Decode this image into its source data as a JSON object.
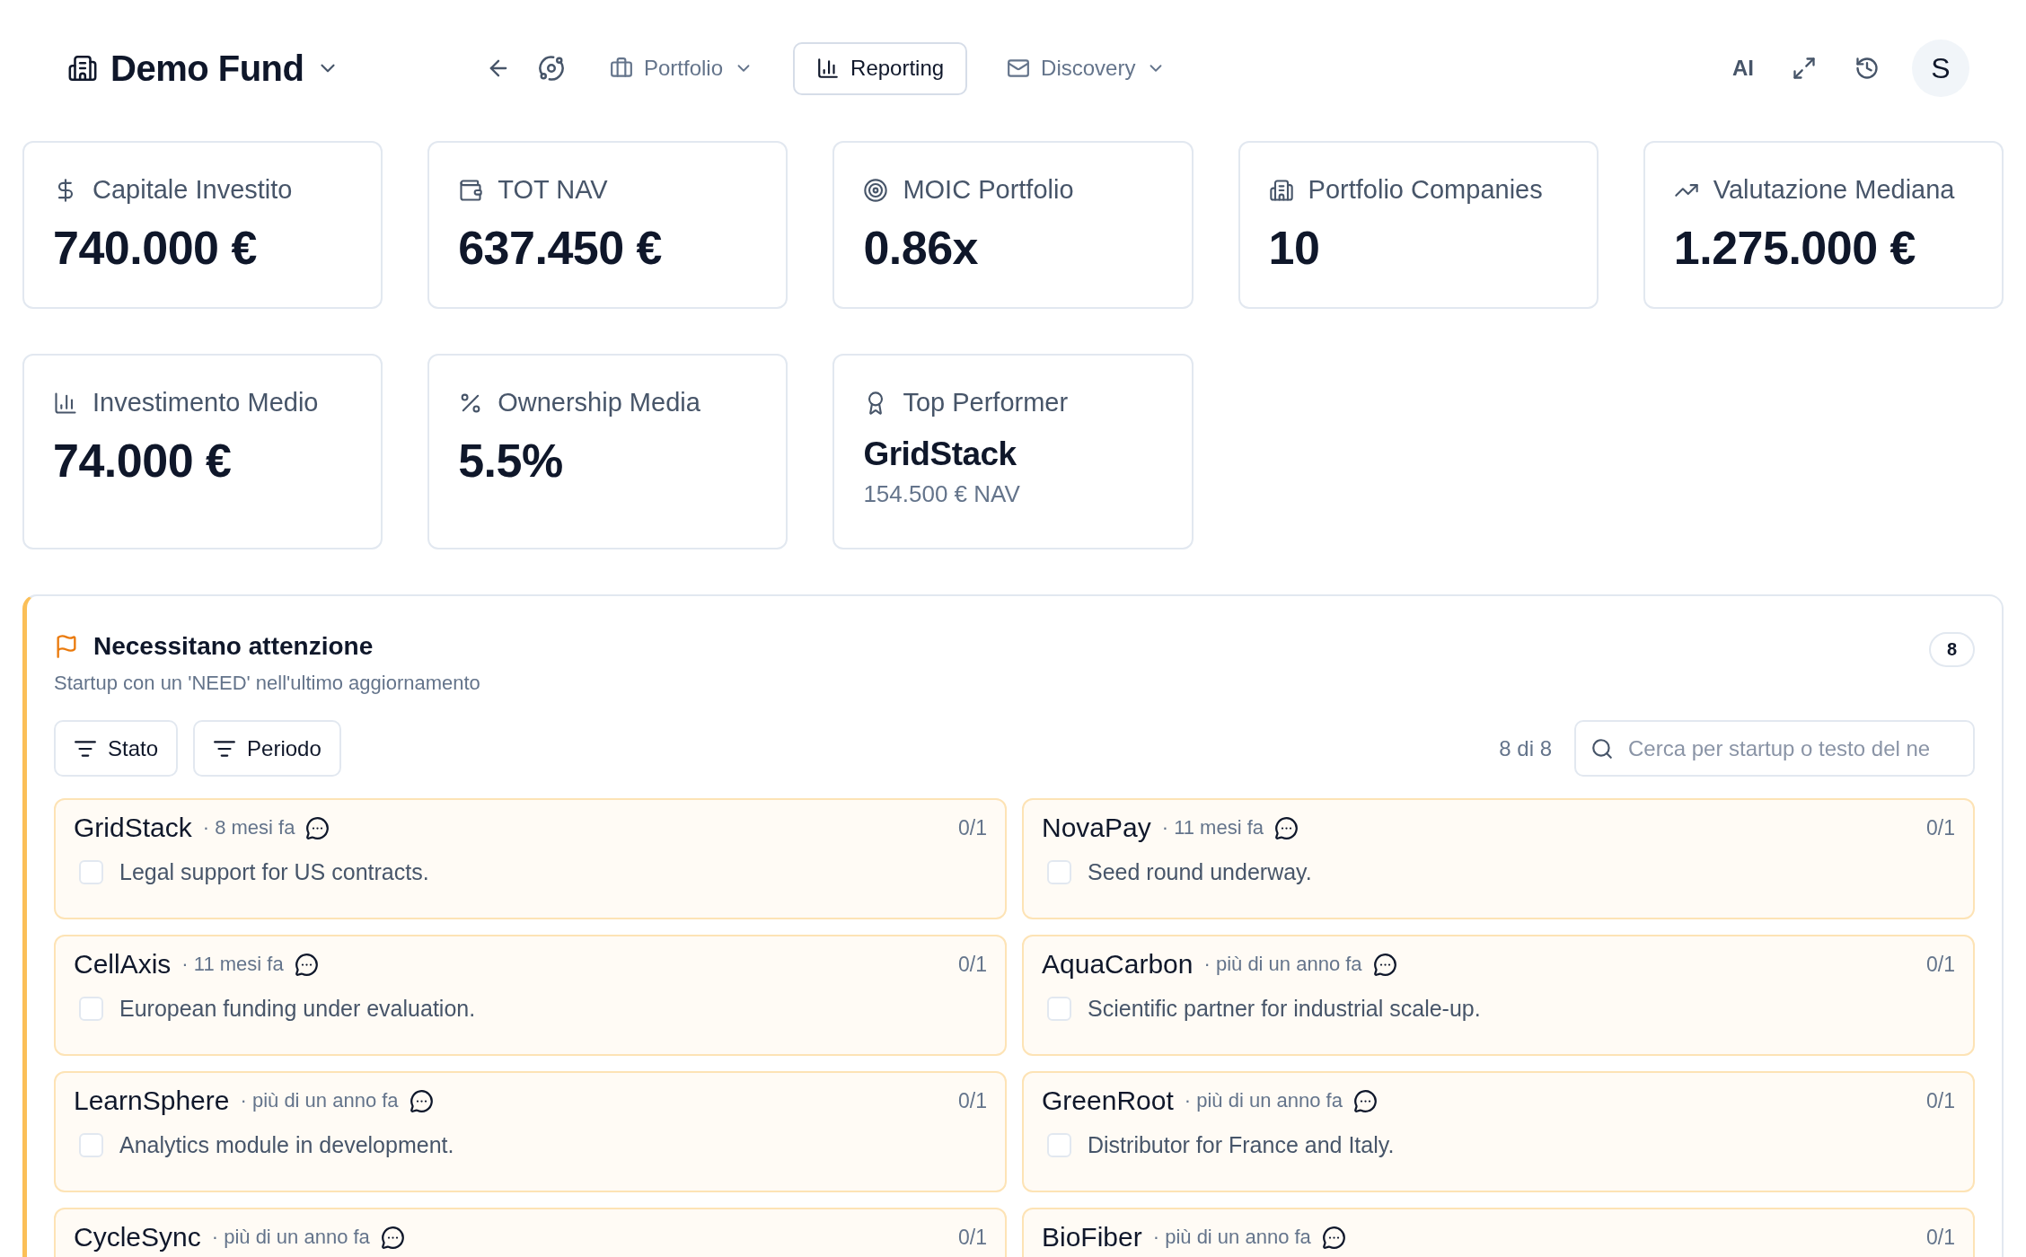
{
  "header": {
    "fund": "Demo Fund",
    "nav": [
      {
        "label": "Portfolio",
        "selected": false,
        "dropdown": true
      },
      {
        "label": "Reporting",
        "selected": true,
        "dropdown": false
      },
      {
        "label": "Discovery",
        "selected": false,
        "dropdown": true
      }
    ],
    "ai": "AI",
    "avatar": "S"
  },
  "stats": [
    {
      "kind": "metric",
      "label": "Capitale Investito",
      "value": "740.000 €"
    },
    {
      "kind": "metric",
      "label": "TOT NAV",
      "value": "637.450 €"
    },
    {
      "kind": "metric",
      "label": "MOIC Portfolio",
      "value": "0.86x"
    },
    {
      "kind": "metric",
      "label": "Portfolio Companies",
      "value": "10"
    },
    {
      "kind": "metric",
      "label": "Valutazione Mediana",
      "value": "1.275.000 €"
    },
    {
      "kind": "metric",
      "label": "Investimento Medio",
      "value": "74.000 €"
    },
    {
      "kind": "metric",
      "label": "Ownership Media",
      "value": "5.5%"
    },
    {
      "kind": "performer",
      "label": "Top Performer",
      "value": "GridStack",
      "sub": "154.500 € NAV"
    }
  ],
  "attention": {
    "title": "Necessitano attenzione",
    "subtitle": "Startup con un 'NEED' nell'ultimo aggiornamento",
    "count": "8",
    "filters": [
      "Stato",
      "Periodo"
    ],
    "shown": "8 di 8",
    "search": {
      "placeholder": "Cerca per startup o testo del ne"
    },
    "items": [
      {
        "name": "GridStack",
        "when": "· 8 mesi fa",
        "progress": "0/1",
        "need": "Legal support for US contracts.",
        "checked": false
      },
      {
        "name": "NovaPay",
        "when": "· 11 mesi fa",
        "progress": "0/1",
        "need": "Seed round underway.",
        "checked": false
      },
      {
        "name": "CellAxis",
        "when": "· 11 mesi fa",
        "progress": "0/1",
        "need": "European funding under evaluation.",
        "checked": false
      },
      {
        "name": "AquaCarbon",
        "when": "· più di un anno fa",
        "progress": "0/1",
        "need": "Scientific partner for industrial scale-up.",
        "checked": false
      },
      {
        "name": "LearnSphere",
        "when": "· più di un anno fa",
        "progress": "0/1",
        "need": "Analytics module in development.",
        "checked": false
      },
      {
        "name": "GreenRoot",
        "when": "· più di un anno fa",
        "progress": "0/1",
        "need": "Distributor for France and Italy.",
        "checked": false
      },
      {
        "name": "CycleSync",
        "when": "· più di un anno fa",
        "progress": "0/1"
      },
      {
        "name": "BioFiber",
        "when": "· più di un anno fa",
        "progress": "0/1"
      }
    ]
  }
}
